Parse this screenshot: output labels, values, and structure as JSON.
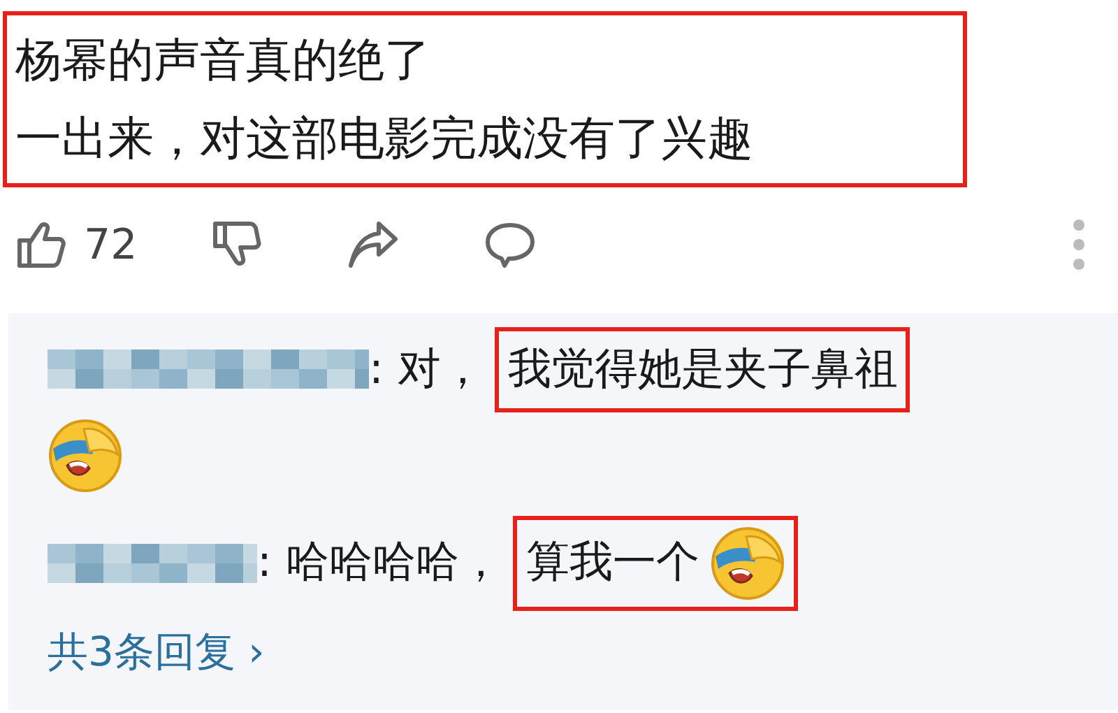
{
  "comment": {
    "lines": [
      "杨幂的声音真的绝了",
      "一出来，对这部电影完成没有了兴趣"
    ],
    "highlighted": true
  },
  "actions": {
    "like_count": "72"
  },
  "replies": [
    {
      "prefix": ": 对，",
      "text": "我觉得她是夹子鼻祖",
      "highlighted": true,
      "kind": "emoji_below"
    },
    {
      "prefix": ": 哈哈哈哈，",
      "text": "算我一个",
      "highlighted": true,
      "kind": "emoji_inline"
    }
  ],
  "more_replies": "共3条回复 ›"
}
